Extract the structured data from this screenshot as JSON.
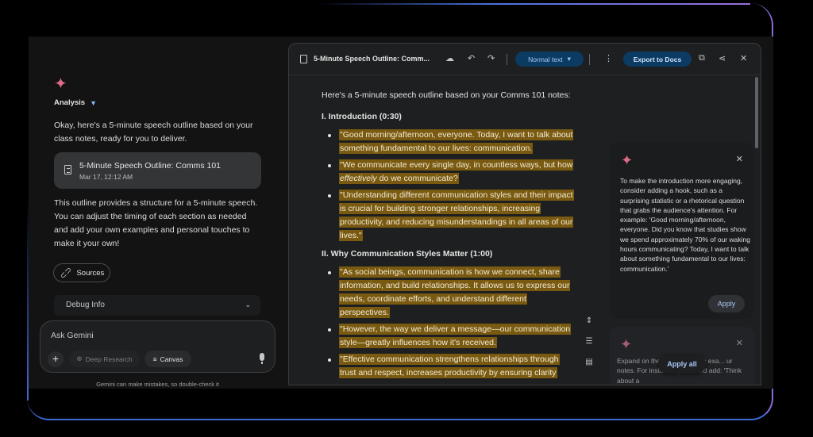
{
  "chat": {
    "analysis_label": "Analysis",
    "response_intro": "Okay, here's a 5-minute speech outline based on your class notes, ready for you to deliver.",
    "doc_card": {
      "title": "5-Minute Speech Outline: Comms 101",
      "date": "Mar 17, 12:12 AM"
    },
    "response_body": "This outline provides a structure for a 5-minute speech.  You can adjust the timing of each section as needed and add your own examples and personal touches to make it your own!",
    "sources_label": "Sources",
    "debug_label": "Debug Info"
  },
  "input": {
    "placeholder": "Ask Gemini",
    "deep_research_label": "Deep Research",
    "canvas_label": "Canvas",
    "disclaimer": "Gemini can make mistakes, so double-check it"
  },
  "doc": {
    "title": "5-Minute Speech Outline: Comm...",
    "normal_text_label": "Normal text",
    "export_label": "Export to Docs",
    "intro": "Here's a 5-minute speech outline based on your Comms 101 notes:",
    "section1_heading": "I. Introduction (0:30)",
    "s1_b1": "\"Good morning/afternoon, everyone. Today, I want to talk about something fundamental to our lives: communication.",
    "s1_b2_pre": "\"We communicate every single day, in countless ways, but how ",
    "s1_b2_em": "effectively",
    "s1_b2_post": " do we communicate?",
    "s1_b3": "\"Understanding different communication styles and their impact is crucial for building stronger relationships, increasing productivity, and reducing misunderstandings in all areas of our lives.\"",
    "section2_heading": "II. Why Communication Styles Matter (1:00)",
    "s2_b1": "\"As social beings, communication is how we connect, share information, and build relationships. It allows us to express our needs, coordinate efforts, and understand different perspectives.",
    "s2_b2": "\"However, the way we deliver a message—our communication style—greatly influences how it's received.",
    "s2_b3": "\"Effective communication strengthens relationships through trust and respect, increases productivity by ensuring clarity"
  },
  "suggestions": {
    "s1_text": "To make the introduction more engaging, consider adding a hook, such as a surprising statistic or a rhetorical question that grabs the audience's attention. For example: 'Good morning/afternoon, everyone. Did you know that studies show we spend approximately 70% of our waking hours communicating? Today, I want to talk about something fundamental to our lives: communication.'",
    "apply_label": "Apply",
    "s2_text": "Expand on the ... with specific exa... ur notes. For instance, you could add: 'Think about a",
    "apply_all_label": "Apply all"
  },
  "colors": {
    "accent_blue": "#a8c7fa",
    "highlight": "#7a5a10",
    "spark": "#e06a8a"
  }
}
